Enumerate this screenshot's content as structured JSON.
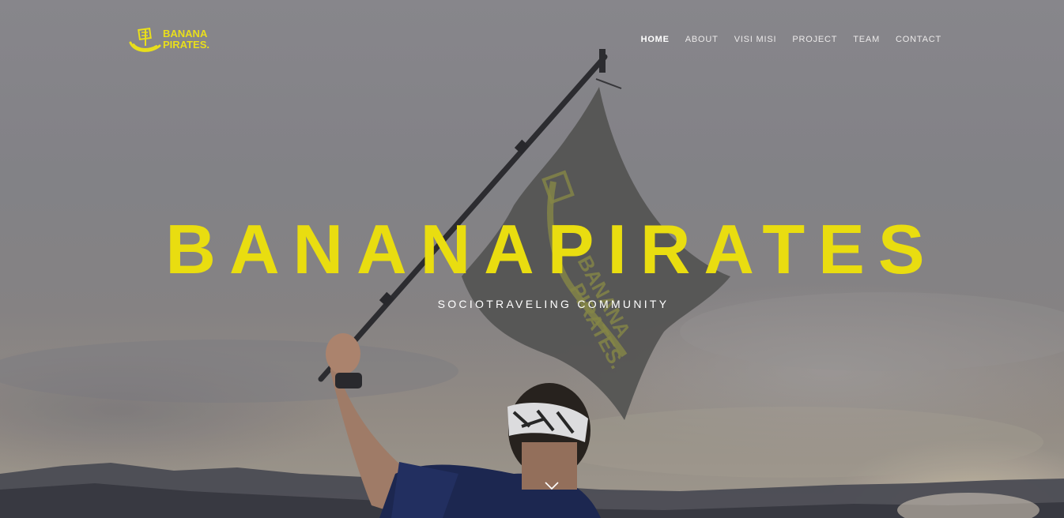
{
  "brand": {
    "logo_line1": "BANANA",
    "logo_line2": "PIRATES.",
    "logo_icon": "banana-ship-icon",
    "accent_color": "#e9dd10"
  },
  "nav": {
    "items": [
      {
        "label": "HOME",
        "active": true
      },
      {
        "label": "ABOUT",
        "active": false
      },
      {
        "label": "VISI MISI",
        "active": false
      },
      {
        "label": "PROJECT",
        "active": false
      },
      {
        "label": "TEAM",
        "active": false
      },
      {
        "label": "CONTACT",
        "active": false
      }
    ]
  },
  "hero": {
    "title": "BANANAPIRATES",
    "subtitle": "SOCIOTRAVELING COMMUNITY",
    "background": "photo of person on a mountain waving a Banana Pirates flag",
    "flag_text_line1": "BANANA",
    "flag_text_line2": "PIRATES.",
    "scroll_icon": "chevron-down-icon"
  }
}
